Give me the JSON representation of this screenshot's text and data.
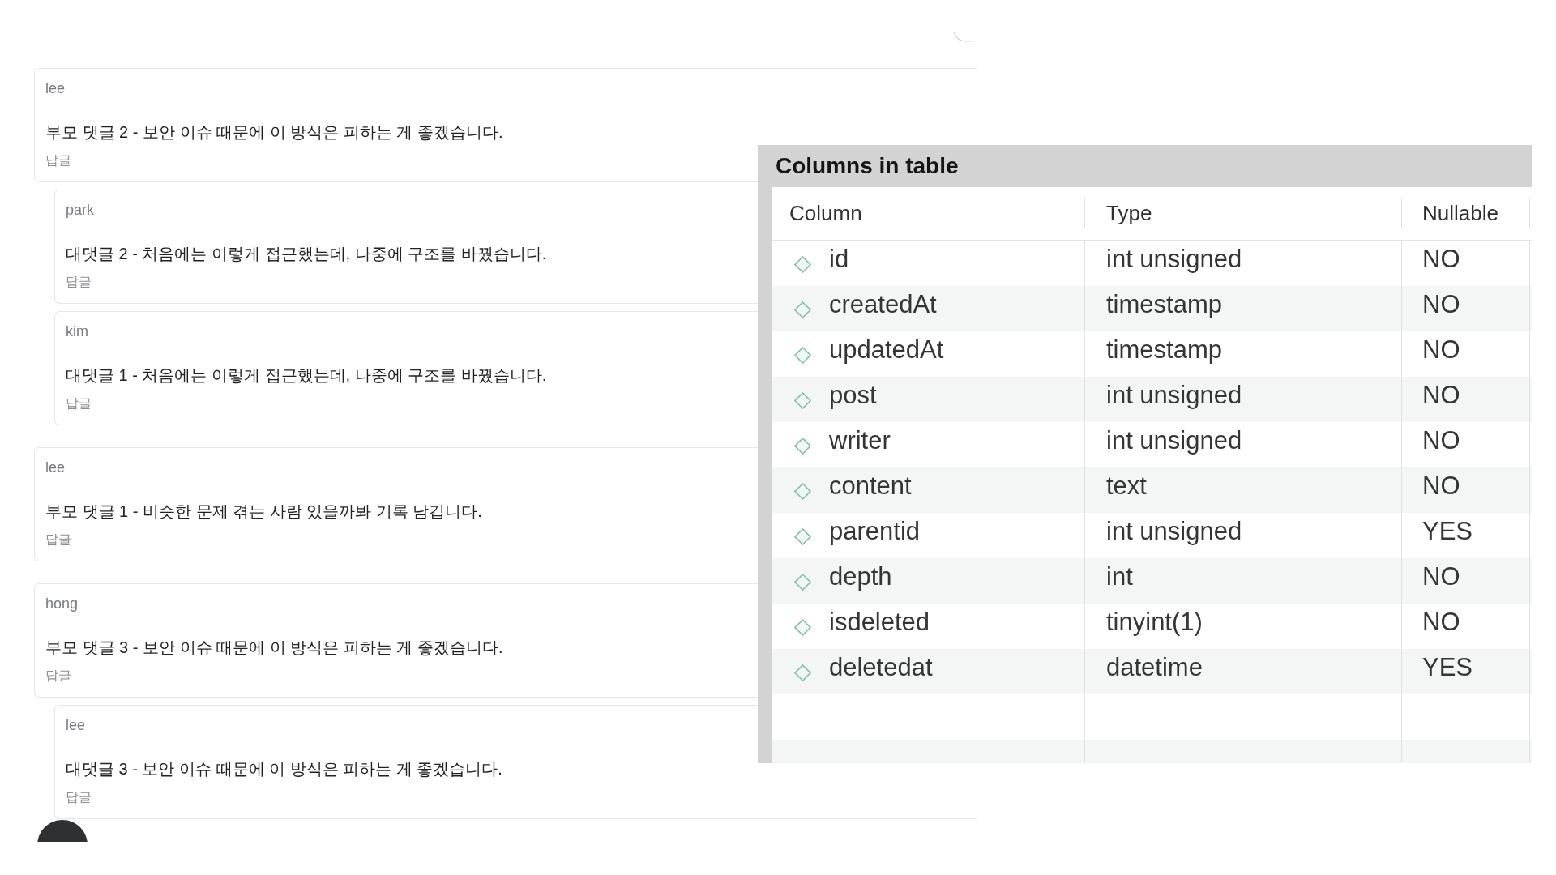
{
  "comments": [
    {
      "author": "lee",
      "text": "부모 댓글 2 - 보안 이슈 때문에 이 방식은 피하는 게 좋겠습니다.",
      "reply": "답글",
      "children": [
        {
          "author": "park",
          "text": "대댓글 2 - 처음에는 이렇게 접근했는데, 나중에 구조를 바꿨습니다.",
          "reply": "답글"
        },
        {
          "author": "kim",
          "text": "대댓글 1 - 처음에는 이렇게 접근했는데, 나중에 구조를 바꿨습니다.",
          "reply": "답글"
        }
      ]
    },
    {
      "author": "lee",
      "text": "부모 댓글 1 - 비슷한 문제 겪는 사람 있을까봐 기록 남깁니다.",
      "reply": "답글"
    },
    {
      "author": "hong",
      "text": "부모 댓글 3 - 보안 이슈 때문에 이 방식은 피하는 게 좋겠습니다.",
      "reply": "답글",
      "children": [
        {
          "author": "lee",
          "text": "대댓글 3 - 보안 이슈 때문에 이 방식은 피하는 게 좋겠습니다.",
          "reply": "답글"
        }
      ]
    }
  ],
  "columns_panel": {
    "title": "Columns in table",
    "table": {
      "columns": [
        "Column",
        "Type",
        "Nullable"
      ],
      "rows": [
        {
          "column": "id",
          "type": "int unsigned",
          "nullable": "NO"
        },
        {
          "column": "createdAt",
          "type": "timestamp",
          "nullable": "NO"
        },
        {
          "column": "updatedAt",
          "type": "timestamp",
          "nullable": "NO"
        },
        {
          "column": "post",
          "type": "int unsigned",
          "nullable": "NO"
        },
        {
          "column": "writer",
          "type": "int unsigned",
          "nullable": "NO"
        },
        {
          "column": "content",
          "type": "text",
          "nullable": "NO"
        },
        {
          "column": "parentid",
          "type": "int unsigned",
          "nullable": "YES"
        },
        {
          "column": "depth",
          "type": "int",
          "nullable": "NO"
        },
        {
          "column": "isdeleted",
          "type": "tinyint(1)",
          "nullable": "NO"
        },
        {
          "column": "deletedat",
          "type": "datetime",
          "nullable": "YES"
        }
      ]
    }
  }
}
